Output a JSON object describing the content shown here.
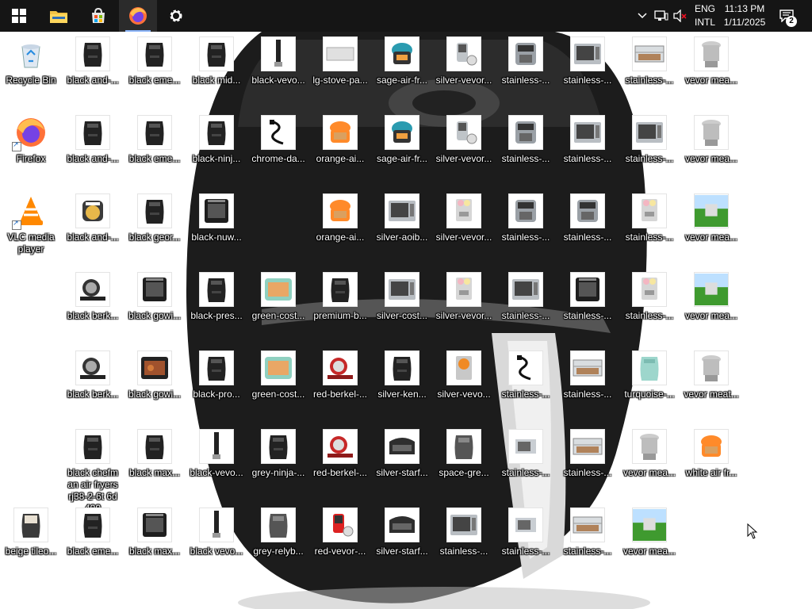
{
  "taskbar": {
    "items": [
      {
        "name": "start-button",
        "icon": "windows-logo-icon"
      },
      {
        "name": "file-explorer-button",
        "icon": "folder-icon"
      },
      {
        "name": "microsoft-store-button",
        "icon": "store-icon"
      },
      {
        "name": "firefox-taskbar-button",
        "icon": "firefox-icon",
        "active": true
      },
      {
        "name": "settings-button",
        "icon": "gear-icon"
      }
    ],
    "tray": {
      "language_line1": "ENG",
      "language_line2": "INTL",
      "time": "11:13 PM",
      "date": "1/11/2025",
      "notification_count": "2"
    }
  },
  "desktop": {
    "icons": [
      {
        "label": "Recycle Bin",
        "kind": "recycle"
      },
      {
        "label": "black and-...",
        "kind": "fryer-black"
      },
      {
        "label": "black eme...",
        "kind": "fryer-black"
      },
      {
        "label": "black mid...",
        "kind": "fryer-black"
      },
      {
        "label": "black-vevo...",
        "kind": "mixer"
      },
      {
        "label": "lg-stove-pa...",
        "kind": "tray"
      },
      {
        "label": "sage-air-fr...",
        "kind": "fryer-teal"
      },
      {
        "label": "silver-vevor...",
        "kind": "distiller"
      },
      {
        "label": "stainless-...",
        "kind": "fryer-steel"
      },
      {
        "label": "stainless-...",
        "kind": "oven"
      },
      {
        "label": "stainless-...",
        "kind": "display"
      },
      {
        "label": "vevor mea...",
        "kind": "grinder"
      },
      {
        "label": "Firefox",
        "kind": "firefox",
        "shortcut": true
      },
      {
        "label": "black and-...",
        "kind": "fryer-black"
      },
      {
        "label": "black eme...",
        "kind": "fryer-black"
      },
      {
        "label": "black-ninj...",
        "kind": "fryer-black"
      },
      {
        "label": "chrome-da...",
        "kind": "cable"
      },
      {
        "label": "orange-ai...",
        "kind": "fryer-orange"
      },
      {
        "label": "sage-air-fr...",
        "kind": "fryer-teal"
      },
      {
        "label": "silver-vevor...",
        "kind": "distiller"
      },
      {
        "label": "stainless-...",
        "kind": "fryer-steel"
      },
      {
        "label": "stainless-...",
        "kind": "oven"
      },
      {
        "label": "stainless-...",
        "kind": "oven"
      },
      {
        "label": "vevor mea...",
        "kind": "grinder"
      },
      {
        "label": "VLC media player",
        "kind": "vlc",
        "shortcut": true,
        "wrap": true
      },
      {
        "label": "black and-...",
        "kind": "fryer-food"
      },
      {
        "label": "black geor...",
        "kind": "fryer-black"
      },
      {
        "label": "black-nuw...",
        "kind": "oven-black"
      },
      {
        "label": "orange-ai...",
        "kind": "fryer-orange"
      },
      {
        "label": "silver-aoib...",
        "kind": "oven"
      },
      {
        "label": "silver-vevor...",
        "kind": "icecream"
      },
      {
        "label": "stainless-...",
        "kind": "fryer-steel"
      },
      {
        "label": "stainless-...",
        "kind": "fryer-steel"
      },
      {
        "label": "stainless-...",
        "kind": "icecream"
      },
      {
        "label": "vevor mea...",
        "kind": "grass"
      },
      {
        "label": "black berk...",
        "kind": "slicer"
      },
      {
        "label": "black gowi...",
        "kind": "oven-black"
      },
      {
        "label": "black-pres...",
        "kind": "fryer-black"
      },
      {
        "label": "green-cost...",
        "kind": "oven-green"
      },
      {
        "label": "premium-b...",
        "kind": "fryer-black"
      },
      {
        "label": "silver-cost...",
        "kind": "oven"
      },
      {
        "label": "silver-vevor...",
        "kind": "icecream"
      },
      {
        "label": "stainless-...",
        "kind": "oven"
      },
      {
        "label": "stainless-...",
        "kind": "oven-black"
      },
      {
        "label": "stainless-...",
        "kind": "icecream"
      },
      {
        "label": "vevor mea...",
        "kind": "grass"
      },
      {
        "label": "black berk...",
        "kind": "slicer"
      },
      {
        "label": "black gowi...",
        "kind": "oven-food"
      },
      {
        "label": "black-pro...",
        "kind": "fryer-black"
      },
      {
        "label": "green-cost...",
        "kind": "oven-green"
      },
      {
        "label": "red-berkel-...",
        "kind": "slicer-red"
      },
      {
        "label": "silver-ken...",
        "kind": "fryer-black"
      },
      {
        "label": "silver-vevo...",
        "kind": "juicer"
      },
      {
        "label": "stainless-...",
        "kind": "cable"
      },
      {
        "label": "stainless-...",
        "kind": "display"
      },
      {
        "label": "turquoise-...",
        "kind": "fryer-turq"
      },
      {
        "label": "vevor meat...",
        "kind": "grinder"
      },
      {
        "label": "black chefm an air fryers rj38-2-6t 6d 400",
        "kind": "fryer-black",
        "wrap": true
      },
      {
        "label": "black max...",
        "kind": "fryer-black"
      },
      {
        "label": "black-vevo...",
        "kind": "mixer"
      },
      {
        "label": "grey-ninja-...",
        "kind": "fryer-black"
      },
      {
        "label": "red-berkel-...",
        "kind": "slicer-red"
      },
      {
        "label": "silver-starf...",
        "kind": "grill"
      },
      {
        "label": "space-gre...",
        "kind": "fryer-grey"
      },
      {
        "label": "stainless-...",
        "kind": "oven-small"
      },
      {
        "label": "stainless-...",
        "kind": "display"
      },
      {
        "label": "vevor mea...",
        "kind": "grinder"
      },
      {
        "label": "white air fr...",
        "kind": "fryer-orange"
      },
      {
        "label": "beige tileo...",
        "kind": "fryer-beige"
      },
      {
        "label": "black eme...",
        "kind": "fryer-black"
      },
      {
        "label": "black max...",
        "kind": "oven-black"
      },
      {
        "label": "black vevo...",
        "kind": "mixer"
      },
      {
        "label": "grey-relyb...",
        "kind": "fryer-grey"
      },
      {
        "label": "red-vevor-...",
        "kind": "distiller-red"
      },
      {
        "label": "silver-starf...",
        "kind": "grill"
      },
      {
        "label": "stainless-...",
        "kind": "oven"
      },
      {
        "label": "stainless-...",
        "kind": "oven-small"
      },
      {
        "label": "stainless-...",
        "kind": "display"
      },
      {
        "label": "vevor mea...",
        "kind": "grass"
      }
    ]
  }
}
